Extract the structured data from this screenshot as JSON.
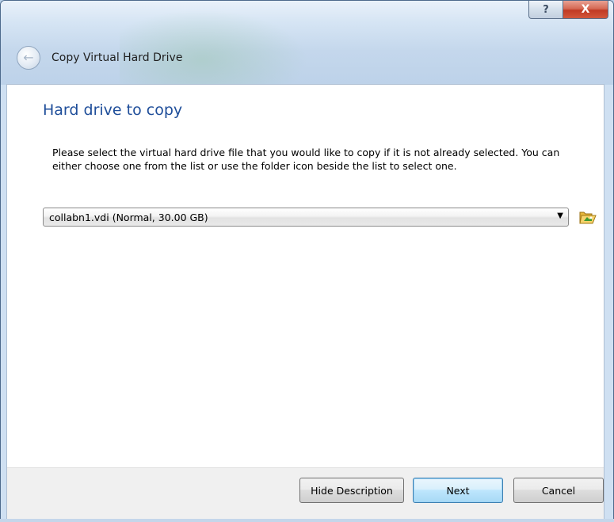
{
  "window": {
    "title": "Copy Virtual Hard Drive",
    "help_label": "?",
    "close_label": "X"
  },
  "page": {
    "heading": "Hard drive to copy",
    "description": "Please select the virtual hard drive file that you would like to copy if it is not already selected. You can either choose one from the list or use the folder icon beside the list to select one."
  },
  "disk_select": {
    "value": "collabn1.vdi (Normal, 30.00 GB)"
  },
  "buttons": {
    "hide_description": "Hide Description",
    "next": "Next",
    "cancel": "Cancel"
  },
  "colors": {
    "heading": "#1f4e9a",
    "next_border": "#3c7fb1",
    "close_red": "#c13a24"
  },
  "icons": {
    "back": "back-arrow-icon",
    "folder": "folder-open-icon",
    "dropdown": "chevron-down-icon",
    "help": "help-icon",
    "close": "close-icon"
  }
}
